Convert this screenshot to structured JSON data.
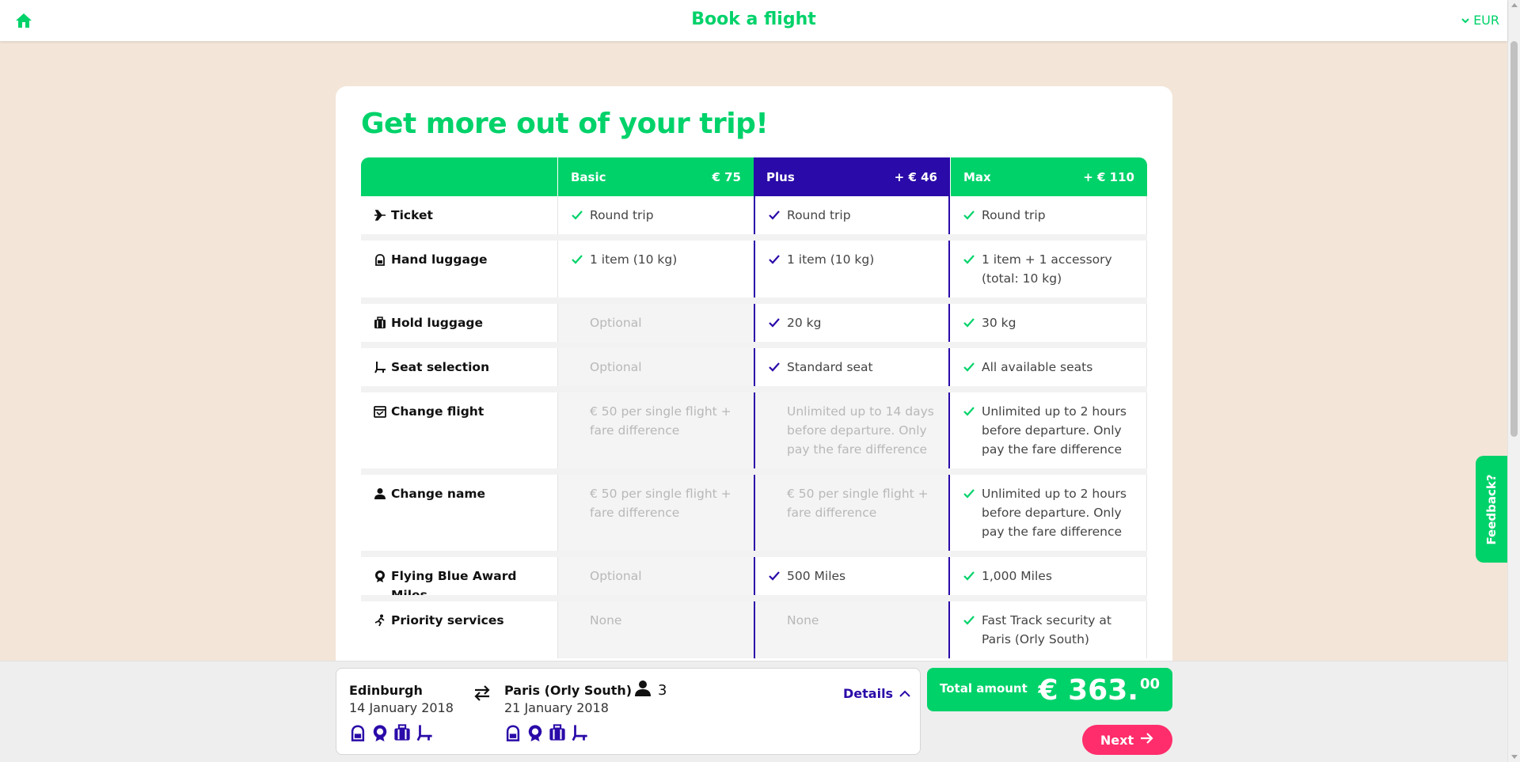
{
  "header": {
    "title": "Book a flight",
    "currency": "EUR"
  },
  "page": {
    "title": "Get more out of your trip!"
  },
  "fare_table": {
    "columns": [
      {
        "name": "Basic",
        "price": "€ 75"
      },
      {
        "name": "Plus",
        "price": "+ € 46"
      },
      {
        "name": "Max",
        "price": "+ € 110"
      }
    ],
    "rows": [
      {
        "label": "Ticket",
        "icon": "plane-icon",
        "values": [
          {
            "text": "Round trip",
            "included": true
          },
          {
            "text": "Round trip",
            "included": true
          },
          {
            "text": "Round trip",
            "included": true
          }
        ]
      },
      {
        "label": "Hand luggage",
        "icon": "backpack-icon",
        "values": [
          {
            "text": "1 item (10 kg)",
            "included": true
          },
          {
            "text": "1 item (10 kg)",
            "included": true
          },
          {
            "text": "1 item + 1 accessory (total: 10 kg)",
            "included": true
          }
        ]
      },
      {
        "label": "Hold luggage",
        "icon": "suitcase-icon",
        "values": [
          {
            "text": "Optional",
            "included": false
          },
          {
            "text": "20 kg",
            "included": true
          },
          {
            "text": "30 kg",
            "included": true
          }
        ]
      },
      {
        "label": "Seat selection",
        "icon": "seat-icon",
        "values": [
          {
            "text": "Optional",
            "included": false
          },
          {
            "text": "Standard seat",
            "included": true
          },
          {
            "text": "All available seats",
            "included": true
          }
        ]
      },
      {
        "label": "Change flight",
        "icon": "calendar-change-icon",
        "values": [
          {
            "text": "€ 50 per single flight + fare difference",
            "included": false
          },
          {
            "text": "Unlimited up to 14 days before departure. Only pay the fare difference",
            "included": false
          },
          {
            "text": "Unlimited up to 2 hours before departure. Only pay the fare difference",
            "included": true
          }
        ]
      },
      {
        "label": "Change name",
        "icon": "person-icon",
        "values": [
          {
            "text": "€ 50 per single flight + fare difference",
            "included": false
          },
          {
            "text": "€ 50 per single flight + fare difference",
            "included": false
          },
          {
            "text": "Unlimited up to 2 hours before departure. Only pay the fare difference",
            "included": true
          }
        ]
      },
      {
        "label": "Flying Blue Award Miles",
        "icon": "award-icon",
        "values": [
          {
            "text": "Optional",
            "included": false
          },
          {
            "text": "500 Miles",
            "included": true
          },
          {
            "text": "1,000 Miles",
            "included": true
          }
        ]
      },
      {
        "label": "Priority services",
        "icon": "running-person-icon",
        "values": [
          {
            "text": "None",
            "included": false
          },
          {
            "text": "None",
            "included": false
          },
          {
            "text": "Fast Track security at Paris (Orly South)",
            "included": true
          }
        ]
      }
    ]
  },
  "summary": {
    "outbound": {
      "city": "Edinburgh",
      "date": "14 January 2018"
    },
    "inbound": {
      "city": "Paris (Orly South)",
      "date": "21 January 2018"
    },
    "passengers": "3",
    "details_label": "Details",
    "services_icons": [
      "backpack-icon",
      "award-icon",
      "suitcase-icon",
      "seat-icon"
    ]
  },
  "total": {
    "label": "Total amount",
    "amount": "€ 363.",
    "cents": "00"
  },
  "next_label": "Next",
  "feedback_label": "Feedback?",
  "colors": {
    "green": "#00d26a",
    "purple": "#2a0aa8",
    "pink": "#ff2d6b",
    "background": "#f3e5d8"
  }
}
